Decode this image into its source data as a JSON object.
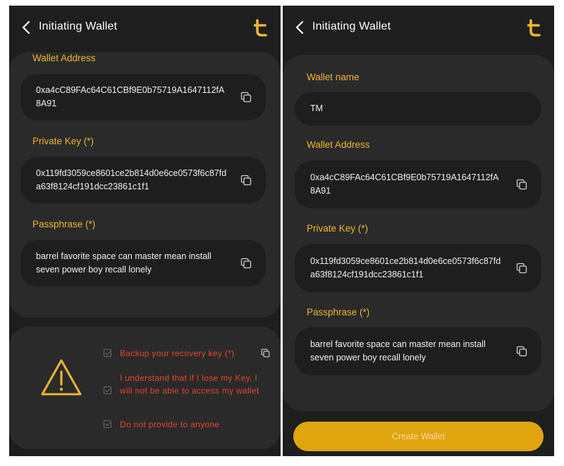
{
  "left": {
    "title": "Initiating Wallet",
    "wallet_address_label": "Wallet Address",
    "wallet_address": "0xa4cC89FAc64C61CBf9E0b75719A1647112fA8A91",
    "private_key_label": "Private Key (*)",
    "private_key": "0x119fd3059ce8601ce2b814d0e6ce0573f6c87fda63f8124cf191dcc23861c1f1",
    "passphrase_label": "Passphrase (*)",
    "passphrase": "barrel favorite space can master mean install seven power boy recall lonely",
    "checklist": [
      "Backup your recovery key (*)",
      "I understand that if I lose my Key, I will not be able to access my wallet",
      "Do not provide to anyone"
    ]
  },
  "right": {
    "title": "Initiating Wallet",
    "wallet_name_label": "Wallet name",
    "wallet_name": "TM",
    "wallet_address_label": "Wallet Address",
    "wallet_address": "0xa4cC89FAc64C61CBf9E0b75719A1647112fA8A91",
    "private_key_label": "Private Key (*)",
    "private_key": "0x119fd3059ce8601ce2b814d0e6ce0573f6c87fda63f8124cf191dcc23861c1f1",
    "passphrase_label": "Passphrase (*)",
    "passphrase": "barrel favorite space can master mean install seven power boy recall lonely",
    "create_button": "Create Wallet"
  },
  "colors": {
    "accent": "#efb530",
    "button": "#e0a40f",
    "warning_text": "#e8452f",
    "background": "#1e1e1e",
    "card": "#2a2a2a"
  },
  "icons": [
    "back-chevron-icon",
    "logo-icon",
    "copy-icon",
    "warning-triangle-icon",
    "checkbox-icon"
  ]
}
